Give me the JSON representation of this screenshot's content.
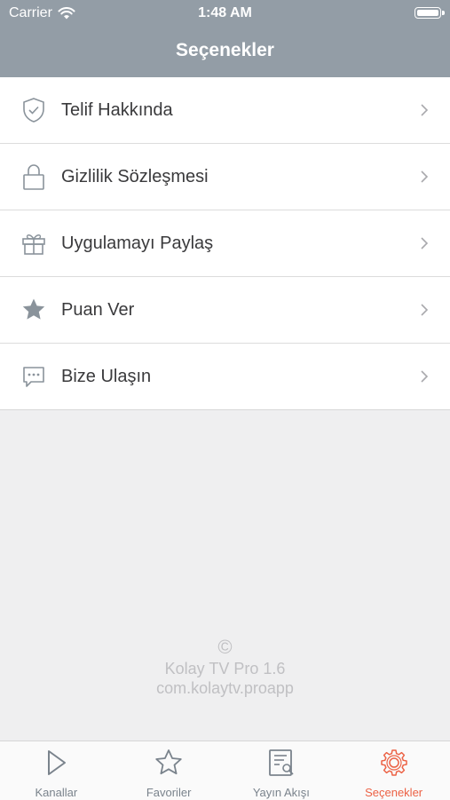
{
  "status_bar": {
    "carrier": "Carrier",
    "time": "1:48 AM"
  },
  "nav": {
    "title": "Seçenekler"
  },
  "menu": [
    {
      "label": "Telif Hakkında",
      "icon": "shield-check-icon"
    },
    {
      "label": "Gizlilik Sözleşmesi",
      "icon": "lock-icon"
    },
    {
      "label": "Uygulamayı Paylaş",
      "icon": "gift-icon"
    },
    {
      "label": "Puan Ver",
      "icon": "star-icon"
    },
    {
      "label": "Bize Ulaşın",
      "icon": "chat-bubble-icon"
    }
  ],
  "footer": {
    "copyright_symbol": "©",
    "app_name": "Kolay TV Pro 1.6",
    "bundle_id": "com.kolaytv.proapp"
  },
  "tabs": [
    {
      "label": "Kanallar",
      "icon": "play-icon"
    },
    {
      "label": "Favoriler",
      "icon": "star-outline-icon"
    },
    {
      "label": "Yayın Akışı",
      "icon": "schedule-search-icon"
    },
    {
      "label": "Seçenekler",
      "icon": "gear-icon",
      "active": true
    }
  ],
  "colors": {
    "header": "#939da6",
    "active_tab": "#ec6245",
    "inactive_tab": "#7a838c",
    "icon_gray": "#8a939b"
  }
}
